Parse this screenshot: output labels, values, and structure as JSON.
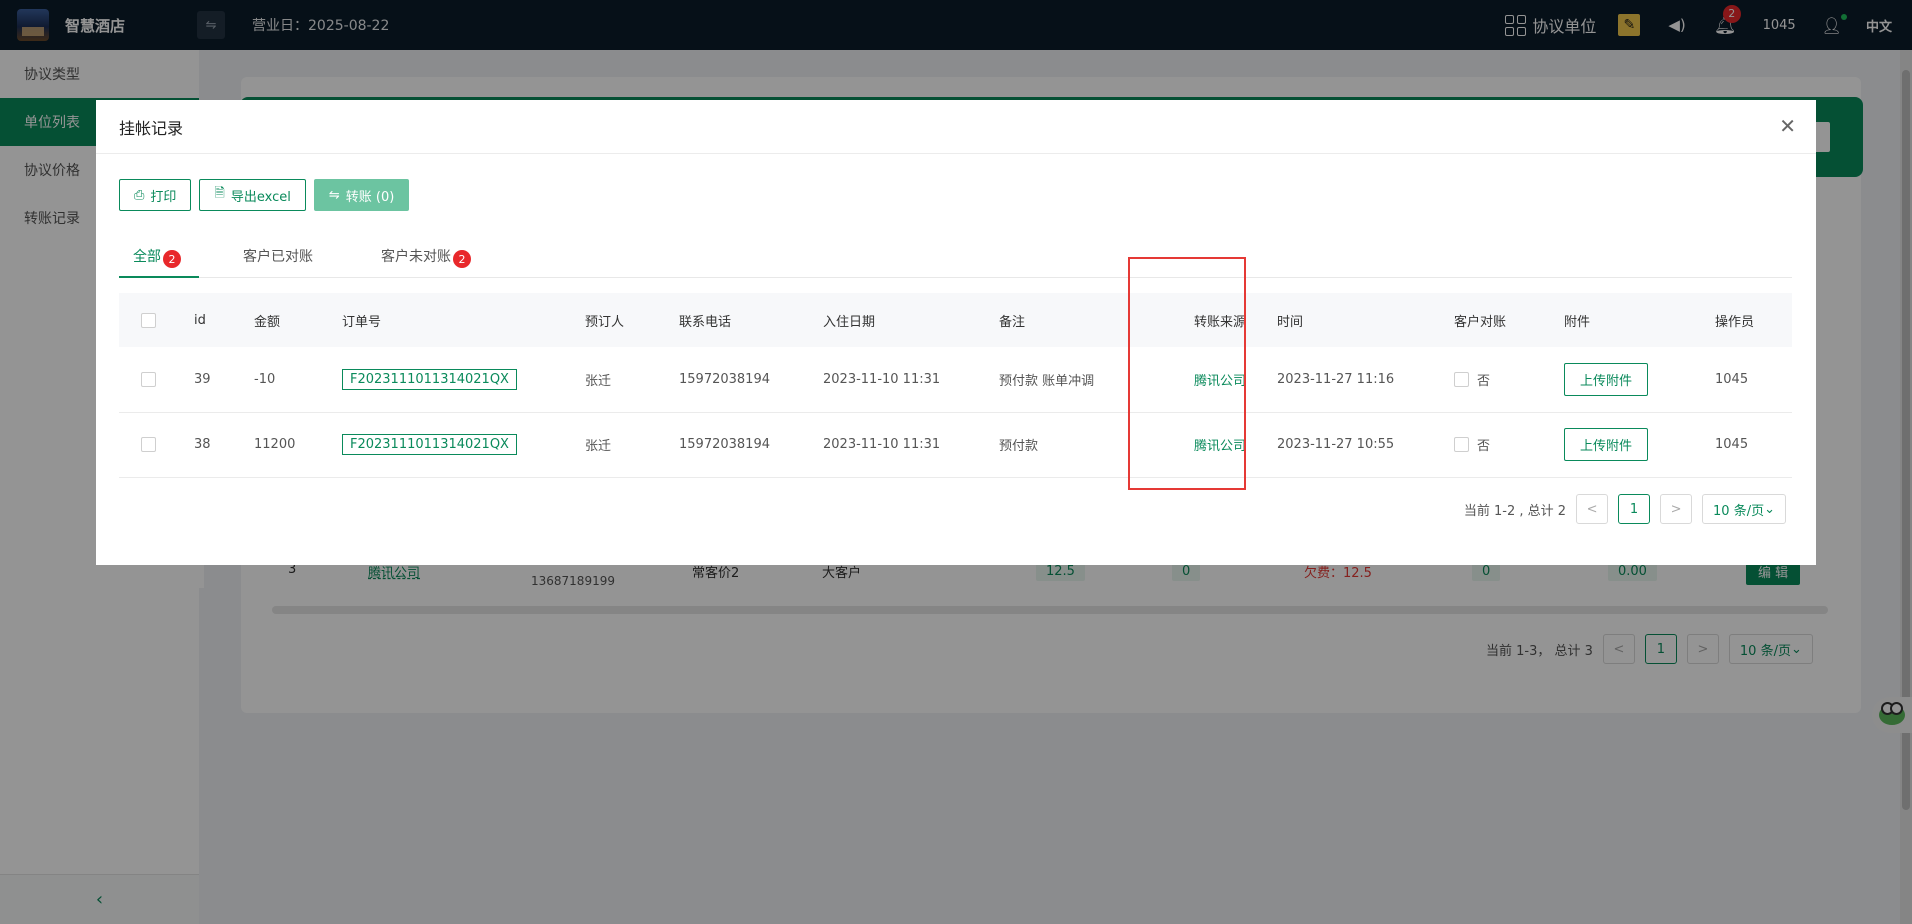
{
  "topbar": {
    "brand": "智慧酒店",
    "toggle_icon": "⇋",
    "business_day": "营业日：2025-08-22",
    "agreement_unit": "协议单位",
    "notification_count": "2",
    "username": "1045",
    "language": "中文"
  },
  "sidebar": {
    "items": [
      {
        "label": "协议类型"
      },
      {
        "label": "单位列表"
      },
      {
        "label": "协议价格"
      },
      {
        "label": "转账记录"
      }
    ],
    "collapse_icon": "‹"
  },
  "background": {
    "row": {
      "index": "3",
      "name": "腾讯公司",
      "plan": "常客价2",
      "type": "大客户",
      "value1": "12.5",
      "value2": "0",
      "owe": "欠费：12.5",
      "value3": "0",
      "value4": "0.00",
      "edit": "编 辑",
      "phone": "13687189199"
    },
    "pager": {
      "summary": "当前 1-3， 总计 3",
      "prev": "<",
      "page": "1",
      "next": ">",
      "size": "10 条/页"
    }
  },
  "dialog": {
    "title": "挂帐记录",
    "close": "✕",
    "toolbar": {
      "print": "打印",
      "print_icon": "⎙",
      "export": "导出excel",
      "export_icon": "🗎",
      "transfer": "转账 (0)",
      "transfer_icon": "⇋"
    },
    "tabs": [
      {
        "label": "全部",
        "badge": "2"
      },
      {
        "label": "客户已对账"
      },
      {
        "label": "客户未对账",
        "badge": "2"
      }
    ],
    "columns": [
      "id",
      "金额",
      "订单号",
      "预订人",
      "联系电话",
      "入住日期",
      "备注",
      "转账来源",
      "时间",
      "客户对账",
      "附件",
      "操作员"
    ],
    "rows": [
      {
        "id": "39",
        "amount": "-10",
        "order": "F2023111011314021QX",
        "booker": "张迁",
        "phone": "15972038194",
        "checkin": "2023-11-10 11:31",
        "note": "预付款 账单冲调",
        "source": "腾讯公司",
        "time": "2023-11-27 11:16",
        "reconciled": "否",
        "upload": "上传附件",
        "operator": "1045"
      },
      {
        "id": "38",
        "amount": "11200",
        "order": "F2023111011314021QX",
        "booker": "张迁",
        "phone": "15972038194",
        "checkin": "2023-11-10 11:31",
        "note": "预付款",
        "source": "腾讯公司",
        "time": "2023-11-27 10:55",
        "reconciled": "否",
        "upload": "上传附件",
        "operator": "1045"
      }
    ],
    "pager": {
      "summary": "当前 1-2 , 总计 2",
      "prev": "<",
      "page": "1",
      "next": ">",
      "size": "10 条/页"
    }
  },
  "colors": {
    "accent": "#0a8a5b",
    "topbar": "#0c1c2a",
    "highlight": "#e53935",
    "badge": "#e8282b"
  }
}
